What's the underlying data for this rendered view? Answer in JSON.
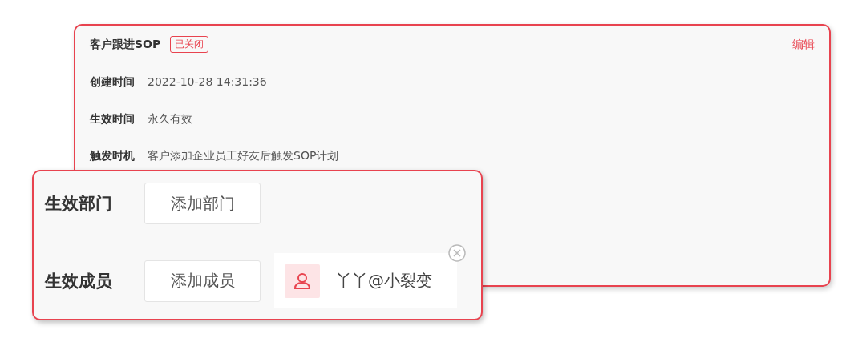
{
  "card": {
    "title": "客户跟进SOP",
    "status": "已关闭",
    "edit": "编辑",
    "fields": [
      {
        "label": "创建时间",
        "value": "2022-10-28 14:31:36"
      },
      {
        "label": "生效时间",
        "value": "永久有效"
      },
      {
        "label": "触发时机",
        "value": "客户添加企业员工好友后触发SOP计划"
      }
    ]
  },
  "scope": {
    "rows": [
      {
        "label": "生效部门",
        "button": "添加部门",
        "members": []
      },
      {
        "label": "生效成员",
        "button": "添加成员",
        "members": [
          {
            "name": "丫丫@小裂变"
          }
        ]
      }
    ]
  }
}
